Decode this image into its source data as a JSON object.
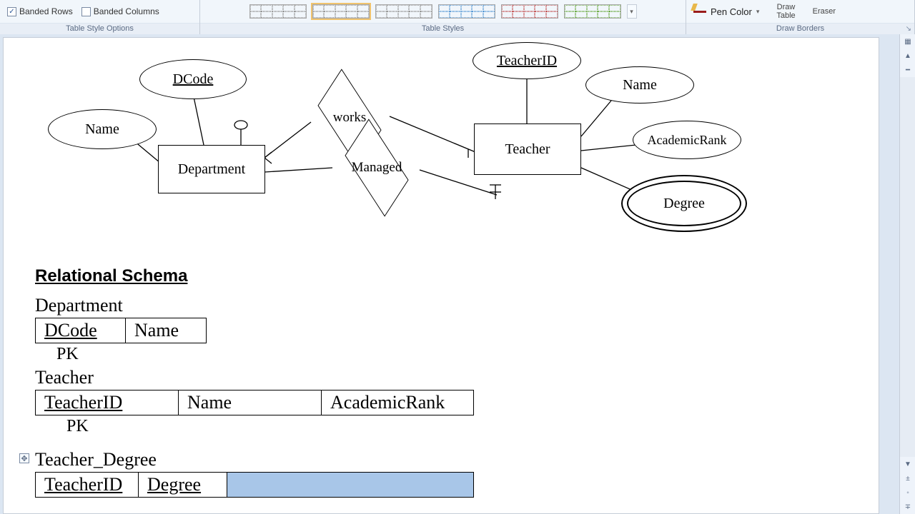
{
  "ribbon": {
    "options": {
      "banded_rows": "Banded Rows",
      "banded_columns": "Banded Columns",
      "group_label": "Table Style Options"
    },
    "styles": {
      "group_label": "Table Styles"
    },
    "borders": {
      "pen_color": "Pen Color",
      "draw_l1": "Draw",
      "draw_l2": "Table",
      "eraser": "Eraser",
      "group_label": "Draw Borders"
    }
  },
  "er": {
    "dcode": "DCode",
    "name1": "Name",
    "department": "Department",
    "works": "works",
    "managed": "Managed",
    "teacher": "Teacher",
    "teacher_id": "TeacherID",
    "name2": "Name",
    "academic_rank": "AcademicRank",
    "degree": "Degree"
  },
  "schema": {
    "title": "Relational Schema",
    "tables": {
      "department": {
        "name": "Department",
        "cols": [
          "DCode",
          "Name"
        ],
        "pk": "PK"
      },
      "teacher": {
        "name": "Teacher",
        "cols": [
          "TeacherID",
          "Name",
          "AcademicRank"
        ],
        "pk": "PK"
      },
      "teacher_degree": {
        "name": "Teacher_Degree",
        "cols": [
          "TeacherID",
          "Degree",
          ""
        ]
      }
    }
  },
  "chart_data": {
    "type": "table",
    "title": "ER Diagram to Relational Schema",
    "entities": [
      {
        "name": "Department",
        "attributes": [
          {
            "name": "DCode",
            "key": true
          },
          {
            "name": "Name"
          }
        ]
      },
      {
        "name": "Teacher",
        "attributes": [
          {
            "name": "TeacherID",
            "key": true
          },
          {
            "name": "Name"
          },
          {
            "name": "AcademicRank"
          },
          {
            "name": "Degree",
            "multivalued": true
          }
        ]
      }
    ],
    "relationships": [
      {
        "name": "works",
        "between": [
          "Department",
          "Teacher"
        ]
      },
      {
        "name": "Managed",
        "between": [
          "Department",
          "Teacher"
        ]
      }
    ],
    "relational_schema": [
      {
        "table": "Department",
        "columns": [
          "DCode",
          "Name"
        ],
        "pk": [
          "DCode"
        ]
      },
      {
        "table": "Teacher",
        "columns": [
          "TeacherID",
          "Name",
          "AcademicRank"
        ],
        "pk": [
          "TeacherID"
        ]
      },
      {
        "table": "Teacher_Degree",
        "columns": [
          "TeacherID",
          "Degree"
        ]
      }
    ]
  }
}
